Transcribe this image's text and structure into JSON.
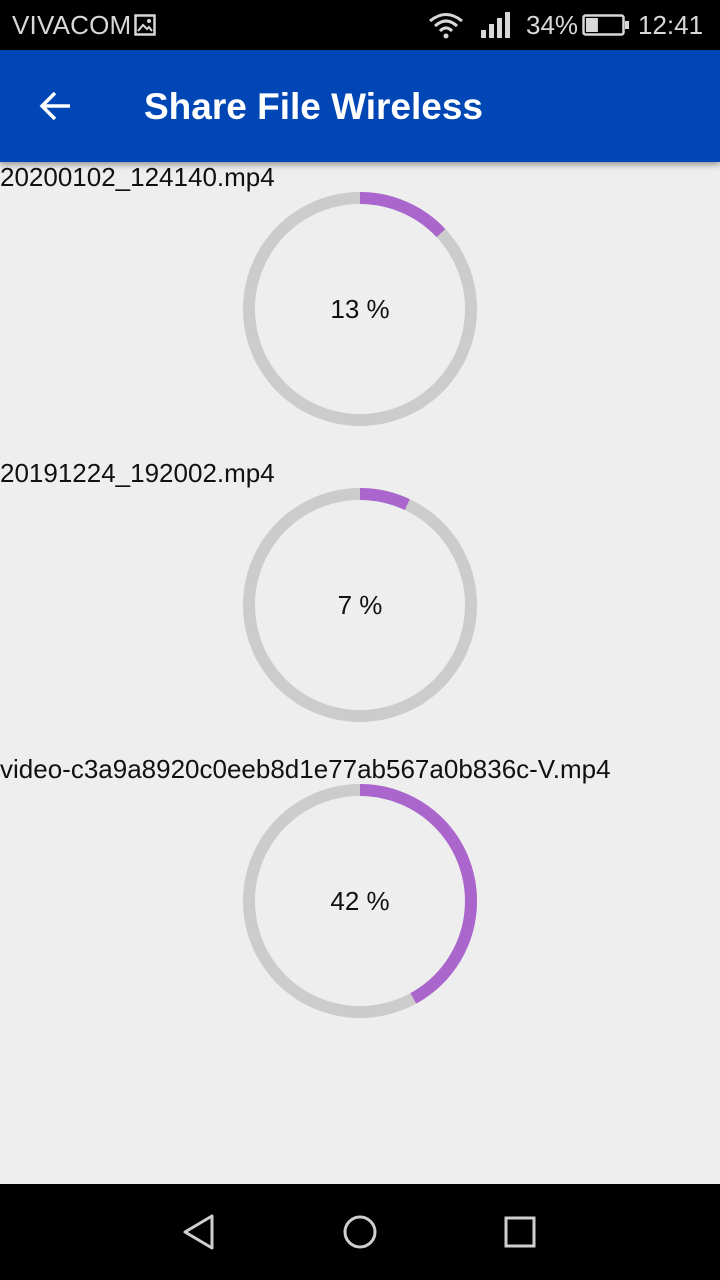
{
  "status_bar": {
    "carrier": "VIVACOM",
    "battery_percent": "34%",
    "battery_level": 0.34,
    "time": "12:41",
    "icons": [
      "image-icon",
      "wifi-icon",
      "signal-icon",
      "battery-icon"
    ]
  },
  "app_bar": {
    "title": "Share File Wireless",
    "back_icon": "arrow-back-icon",
    "color": "#0047b5"
  },
  "transfers": [
    {
      "file_name": "20200102_124140.mp4",
      "progress": 13,
      "progress_label": "13 %"
    },
    {
      "file_name": "20191224_192002.mp4",
      "progress": 7,
      "progress_label": "7 %"
    },
    {
      "file_name": "video-c3a9a8920c0eeb8d1e77ab567a0b836c-V.mp4",
      "progress": 42,
      "progress_label": "42 %"
    }
  ],
  "colors": {
    "progress": "#aa66cc",
    "track": "#cccccc",
    "background": "#eeeeee"
  },
  "nav_bar": {
    "icons": [
      "nav-back-icon",
      "nav-home-icon",
      "nav-recents-icon"
    ]
  }
}
